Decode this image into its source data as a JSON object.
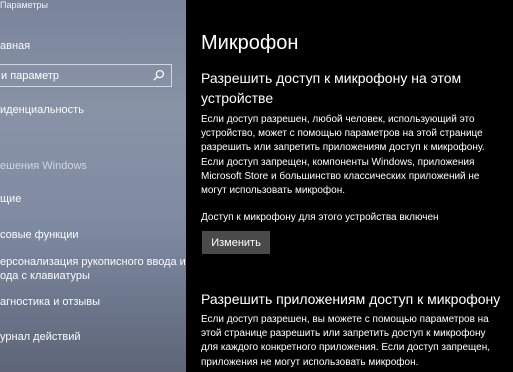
{
  "window": {
    "title": "Параметры"
  },
  "sidebar": {
    "home": "авная",
    "search_placeholder": "и параметр",
    "items": [
      {
        "label": "иденциальность"
      },
      {
        "label": "ешения Windows"
      },
      {
        "label": "щие"
      },
      {
        "label": "совые функции"
      },
      {
        "label": "ерсонализация рукописного ввода и"
      },
      {
        "label": "ода с клавиатуры"
      },
      {
        "label": "агностика и отзывы"
      },
      {
        "label": "урнал действий"
      }
    ]
  },
  "main": {
    "title": "Микрофон",
    "device_section": {
      "heading": "Разрешить доступ к микрофону на этом устройстве",
      "description": "Если доступ разрешен, любой человек, использующий это устройство, может с помощью параметров на этой странице разрешить или запретить приложениям доступ к микрофону. Если доступ запрещен, компоненты Windows, приложения Microsoft Store и большинство классических приложений не могут использовать микрофон.",
      "status": "Доступ к микрофону для этого устройства включен",
      "change_button": "Изменить"
    },
    "apps_section": {
      "heading": "Разрешить приложениям доступ к микрофону",
      "description": "Если доступ разрешен, вы можете с помощью параметров на этой странице разрешить или запретить доступ к микрофону для каждого конкретного приложения. Если доступ запрещен, приложения не могут использовать микрофон."
    }
  },
  "icons": {
    "search": "search-icon"
  }
}
